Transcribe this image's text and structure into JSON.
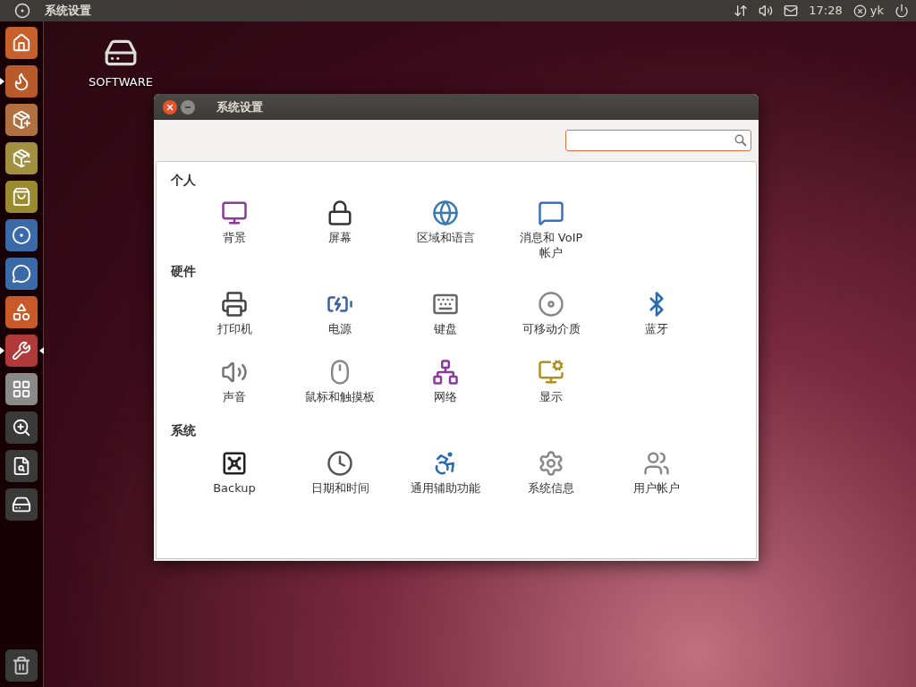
{
  "top_panel": {
    "title": "系统设置",
    "clock": "17:28",
    "user": "yk"
  },
  "launcher": {
    "items": [
      {
        "running": false,
        "focused": false,
        "color": "#c8602e"
      },
      {
        "running": true,
        "focused": false,
        "color": "#b85a2a"
      },
      {
        "running": false,
        "focused": false,
        "color": "#b07040"
      },
      {
        "running": false,
        "focused": false,
        "color": "#a09040"
      },
      {
        "running": false,
        "focused": false,
        "color": "#9a8a30"
      },
      {
        "running": false,
        "focused": false,
        "color": "#3a6aa8"
      },
      {
        "running": false,
        "focused": false,
        "color": "#3a6aa8"
      },
      {
        "running": false,
        "focused": false,
        "color": "#c85a2a"
      },
      {
        "running": true,
        "focused": true,
        "color": "#b03a3a"
      },
      {
        "running": false,
        "focused": false,
        "color": "#8a8a8a"
      },
      {
        "running": false,
        "focused": false,
        "color": "#3a3a3a"
      },
      {
        "running": false,
        "focused": false,
        "color": "#3a3a3a"
      },
      {
        "running": false,
        "focused": false,
        "color": "#3a3a3a"
      }
    ],
    "trash": {
      "running": false
    }
  },
  "desktop": {
    "icons": [
      {
        "label": "SOFTWARE"
      }
    ]
  },
  "window": {
    "title": "系统设置",
    "sections": [
      {
        "title": "个人",
        "items": [
          {
            "label": "背景"
          },
          {
            "label": "屏幕"
          },
          {
            "label": "区域和语言"
          },
          {
            "label": "消息和 VoIP 帐户"
          }
        ]
      },
      {
        "title": "硬件",
        "items": [
          {
            "label": "打印机"
          },
          {
            "label": "电源"
          },
          {
            "label": "键盘"
          },
          {
            "label": "可移动介质"
          },
          {
            "label": "蓝牙"
          },
          {
            "label": "声音"
          },
          {
            "label": "鼠标和触摸板"
          },
          {
            "label": "网络"
          },
          {
            "label": "显示"
          }
        ]
      },
      {
        "title": "系统",
        "items": [
          {
            "label": "Backup"
          },
          {
            "label": "日期和时间"
          },
          {
            "label": "通用辅助功能"
          },
          {
            "label": "系统信息"
          },
          {
            "label": "用户帐户"
          }
        ]
      }
    ]
  }
}
